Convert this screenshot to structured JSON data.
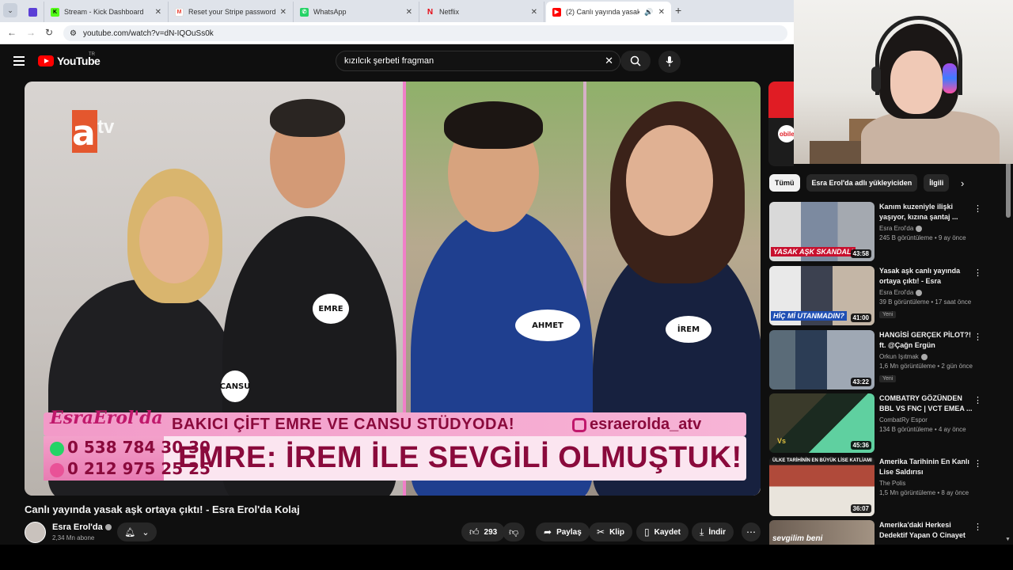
{
  "browser": {
    "tabs": [
      {
        "title": "Stream - Kick Dashboard",
        "favicon": "kick-icon",
        "color": "#53fc18"
      },
      {
        "title": "Reset your Stripe password - m",
        "favicon": "gmail-icon",
        "color": "#ea4335"
      },
      {
        "title": "WhatsApp",
        "favicon": "whatsapp-icon",
        "color": "#25d366"
      },
      {
        "title": "Netflix",
        "favicon": "netflix-icon",
        "color": "#e50914"
      },
      {
        "title": "(2) Canlı yayında yasak aşk",
        "favicon": "youtube-icon",
        "color": "#ff0000"
      }
    ],
    "url": "youtube.com/watch?v=dN-IQOuSs0k"
  },
  "youtube": {
    "logo": "YouTube",
    "country": "TR",
    "search_query": "kızılcık şerbeti fragman"
  },
  "video": {
    "overlay": {
      "channel_logo": "atv",
      "brand": "EsraErol'da",
      "headline_top": "BAKICI ÇİFT EMRE VE CANSU STÜDYODA!",
      "instagram": "esraerolda_atv",
      "phone1": "0 538 784 30 30",
      "phone2": "0 212 975 25 25",
      "headline_main": "EMRE: İREM İLE SEVGİLİ OLMUŞTUK!",
      "name_tags": [
        "CANSU",
        "EMRE",
        "AHMET",
        "İREM"
      ]
    },
    "title": "Canlı yayında yasak aşk ortaya çıktı! - Esra Erol'da Kolaj",
    "channel": "Esra Erol'da",
    "subscribers": "2,34 Mn abone",
    "likes": "293",
    "share_label": "Paylaş",
    "clip_label": "Klip",
    "save_label": "Kaydet",
    "download_label": "İndir"
  },
  "sidebar": {
    "ad_text": "obile",
    "chips": [
      "Tümü",
      "Esra Erol'da adlı yükleyiciden",
      "İlgili"
    ],
    "recommendations": [
      {
        "title": "Kanım kuzeniyle ilişki yaşıyor, kızına şantaj ...",
        "channel": "Esra Erol'da",
        "meta": "245 B görüntüleme • 9 ay önce",
        "duration": "43:58",
        "caption": "YASAK AŞK SKANDALI",
        "badge": ""
      },
      {
        "title": "Yasak aşk canlı yayında ortaya çıktı! - Esra Erol'da...",
        "channel": "Esra Erol'da",
        "meta": "39 B görüntüleme • 17 saat önce",
        "duration": "41:00",
        "caption": "HİÇ Mİ UTANMADIN?",
        "badge": "Yeni"
      },
      {
        "title": "HANGİSİ GERÇEK PİLOT?! ft. @Çağn Ergün",
        "channel": "Orkun Işıtmak",
        "meta": "1,6 Mn görüntüleme • 2 gün önce",
        "duration": "43:22",
        "caption": "",
        "badge": "Yeni"
      },
      {
        "title": "COMBATRY GÖZÜNDEN BBL VS FNC | VCT EMEA ...",
        "channel": "CombatRy Espor",
        "meta": "134 B görüntüleme • 4 ay önce",
        "duration": "45:36",
        "caption": "",
        "badge": ""
      },
      {
        "title": "Amerika Tarihinin En Kanlı Lise Saldırısı",
        "channel": "The Polis",
        "meta": "1,5 Mn görüntüleme • 8 ay önce",
        "duration": "36:07",
        "caption": "ÜLKE TARİHİNİN EN BÜYÜK LİSE KATLİAMI",
        "badge": ""
      },
      {
        "title": "Amerika'daki Herkesi Dedektif Yapan O Cinayet",
        "channel": "",
        "meta": "",
        "duration": "",
        "caption": "sevgilim beni",
        "badge": ""
      }
    ]
  }
}
